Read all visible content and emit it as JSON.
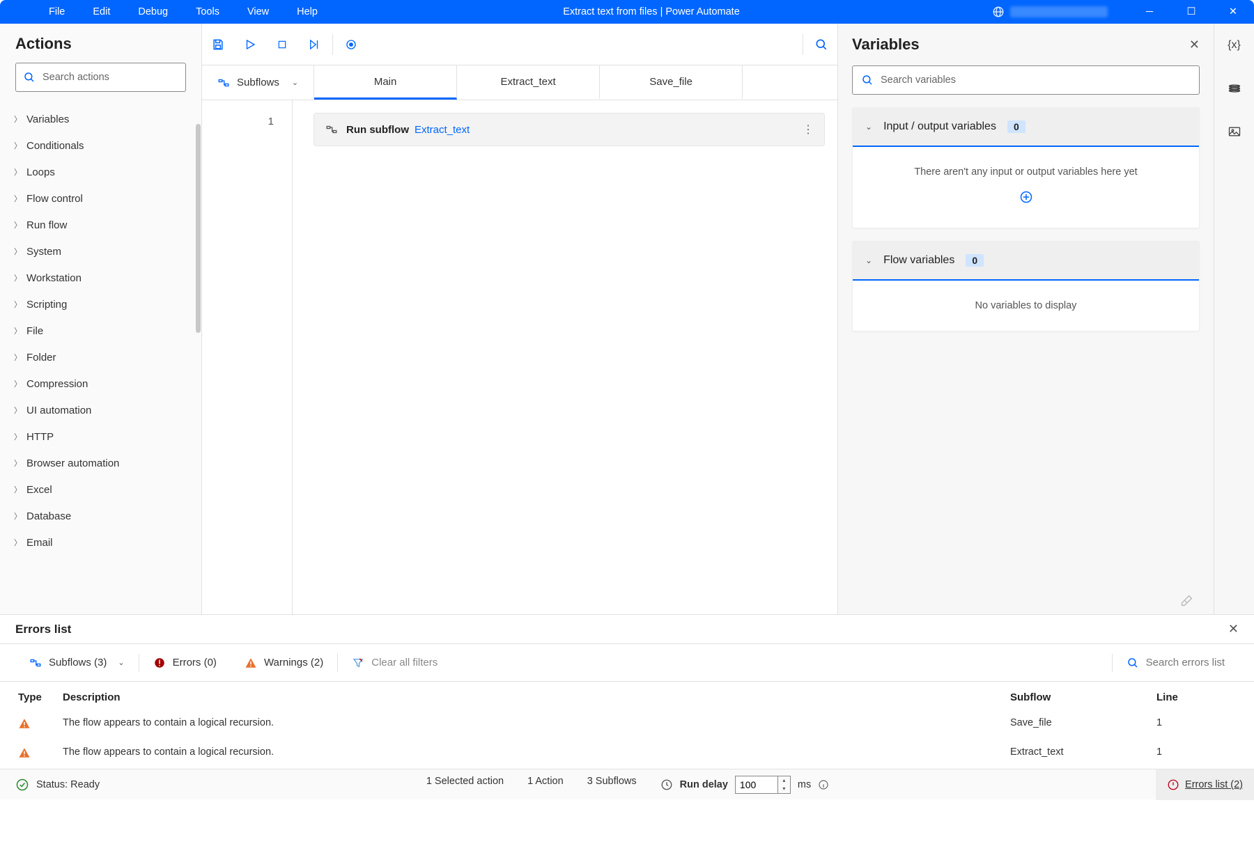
{
  "window": {
    "title": "Extract text from files | Power Automate",
    "menu": [
      "File",
      "Edit",
      "Debug",
      "Tools",
      "View",
      "Help"
    ]
  },
  "actions": {
    "title": "Actions",
    "search_placeholder": "Search actions",
    "categories": [
      "Variables",
      "Conditionals",
      "Loops",
      "Flow control",
      "Run flow",
      "System",
      "Workstation",
      "Scripting",
      "File",
      "Folder",
      "Compression",
      "UI automation",
      "HTTP",
      "Browser automation",
      "Excel",
      "Database",
      "Email"
    ]
  },
  "tabs": {
    "subflows_label": "Subflows",
    "items": [
      "Main",
      "Extract_text",
      "Save_file"
    ],
    "active": "Main"
  },
  "flow": {
    "steps": [
      {
        "line": "1",
        "action_label": "Run subflow",
        "subflow_link": "Extract_text"
      }
    ]
  },
  "variables": {
    "title": "Variables",
    "search_placeholder": "Search variables",
    "io_section": {
      "title": "Input / output variables",
      "count": "0",
      "empty_text": "There aren't any input or output variables here yet"
    },
    "flow_section": {
      "title": "Flow variables",
      "count": "0",
      "empty_text": "No variables to display"
    }
  },
  "sidetabs": {
    "vars": "{x}"
  },
  "errors": {
    "title": "Errors list",
    "filters": {
      "subflows_label": "Subflows (3)",
      "errors_label": "Errors (0)",
      "warnings_label": "Warnings (2)",
      "clear_label": "Clear all filters",
      "search_placeholder": "Search errors list"
    },
    "headers": {
      "type": "Type",
      "description": "Description",
      "subflow": "Subflow",
      "line": "Line"
    },
    "rows": [
      {
        "type": "warning",
        "description": "The flow appears to contain a logical recursion.",
        "subflow": "Save_file",
        "line": "1"
      },
      {
        "type": "warning",
        "description": "The flow appears to contain a logical recursion.",
        "subflow": "Extract_text",
        "line": "1"
      }
    ]
  },
  "status": {
    "ready": "Status: Ready",
    "selected": "1 Selected action",
    "actions_count": "1 Action",
    "subflows_count": "3 Subflows",
    "run_delay_label": "Run delay",
    "run_delay_value": "100",
    "run_delay_unit": "ms",
    "errors_link": "Errors list (2)"
  }
}
